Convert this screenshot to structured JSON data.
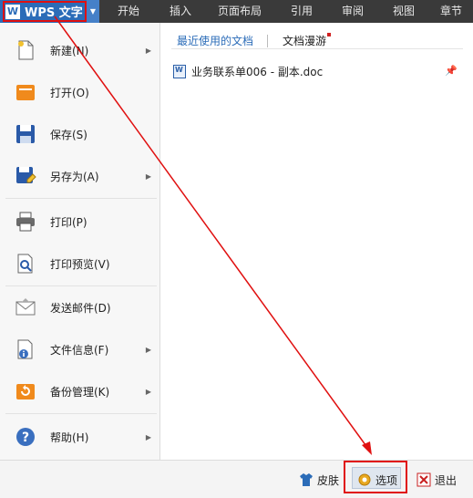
{
  "app": {
    "title": "WPS 文字",
    "logo_glyph": "W",
    "menu_dropdown_glyph": "▼"
  },
  "ribbon_tabs": [
    {
      "label": "开始"
    },
    {
      "label": "插入"
    },
    {
      "label": "页面布局"
    },
    {
      "label": "引用"
    },
    {
      "label": "审阅"
    },
    {
      "label": "视图"
    },
    {
      "label": "章节"
    }
  ],
  "menu": {
    "items": [
      {
        "label": "新建(N)",
        "icon": "new-document-icon",
        "has_submenu": true
      },
      {
        "label": "打开(O)",
        "icon": "open-folder-icon",
        "has_submenu": false
      },
      {
        "label": "保存(S)",
        "icon": "save-disk-icon",
        "has_submenu": false
      },
      {
        "label": "另存为(A)",
        "icon": "save-as-icon",
        "has_submenu": true
      },
      {
        "label": "打印(P)",
        "icon": "printer-icon",
        "has_submenu": false
      },
      {
        "label": "打印预览(V)",
        "icon": "print-preview-icon",
        "has_submenu": false
      },
      {
        "label": "发送邮件(D)",
        "icon": "mail-envelope-icon",
        "has_submenu": false
      },
      {
        "label": "文件信息(F)",
        "icon": "file-info-icon",
        "has_submenu": true
      },
      {
        "label": "备份管理(K)",
        "icon": "backup-folder-icon",
        "has_submenu": true
      },
      {
        "label": "帮助(H)",
        "icon": "help-icon",
        "has_submenu": true
      }
    ],
    "submenu_arrow": "▶"
  },
  "panel": {
    "tabs": [
      {
        "label": "最近使用的文档",
        "active": true
      },
      {
        "label": "文档漫游",
        "active": false
      }
    ],
    "recent_documents": [
      {
        "name": "业务联系单006 - 副本.doc",
        "pinned": true
      }
    ],
    "pin_glyph": "📌"
  },
  "bottom": {
    "skin_label": "皮肤",
    "options_label": "选项",
    "exit_label": "退出"
  },
  "colors": {
    "accent": "#2b6cb8",
    "highlight_red": "#e01010",
    "topbar": "#3a3a3a"
  }
}
